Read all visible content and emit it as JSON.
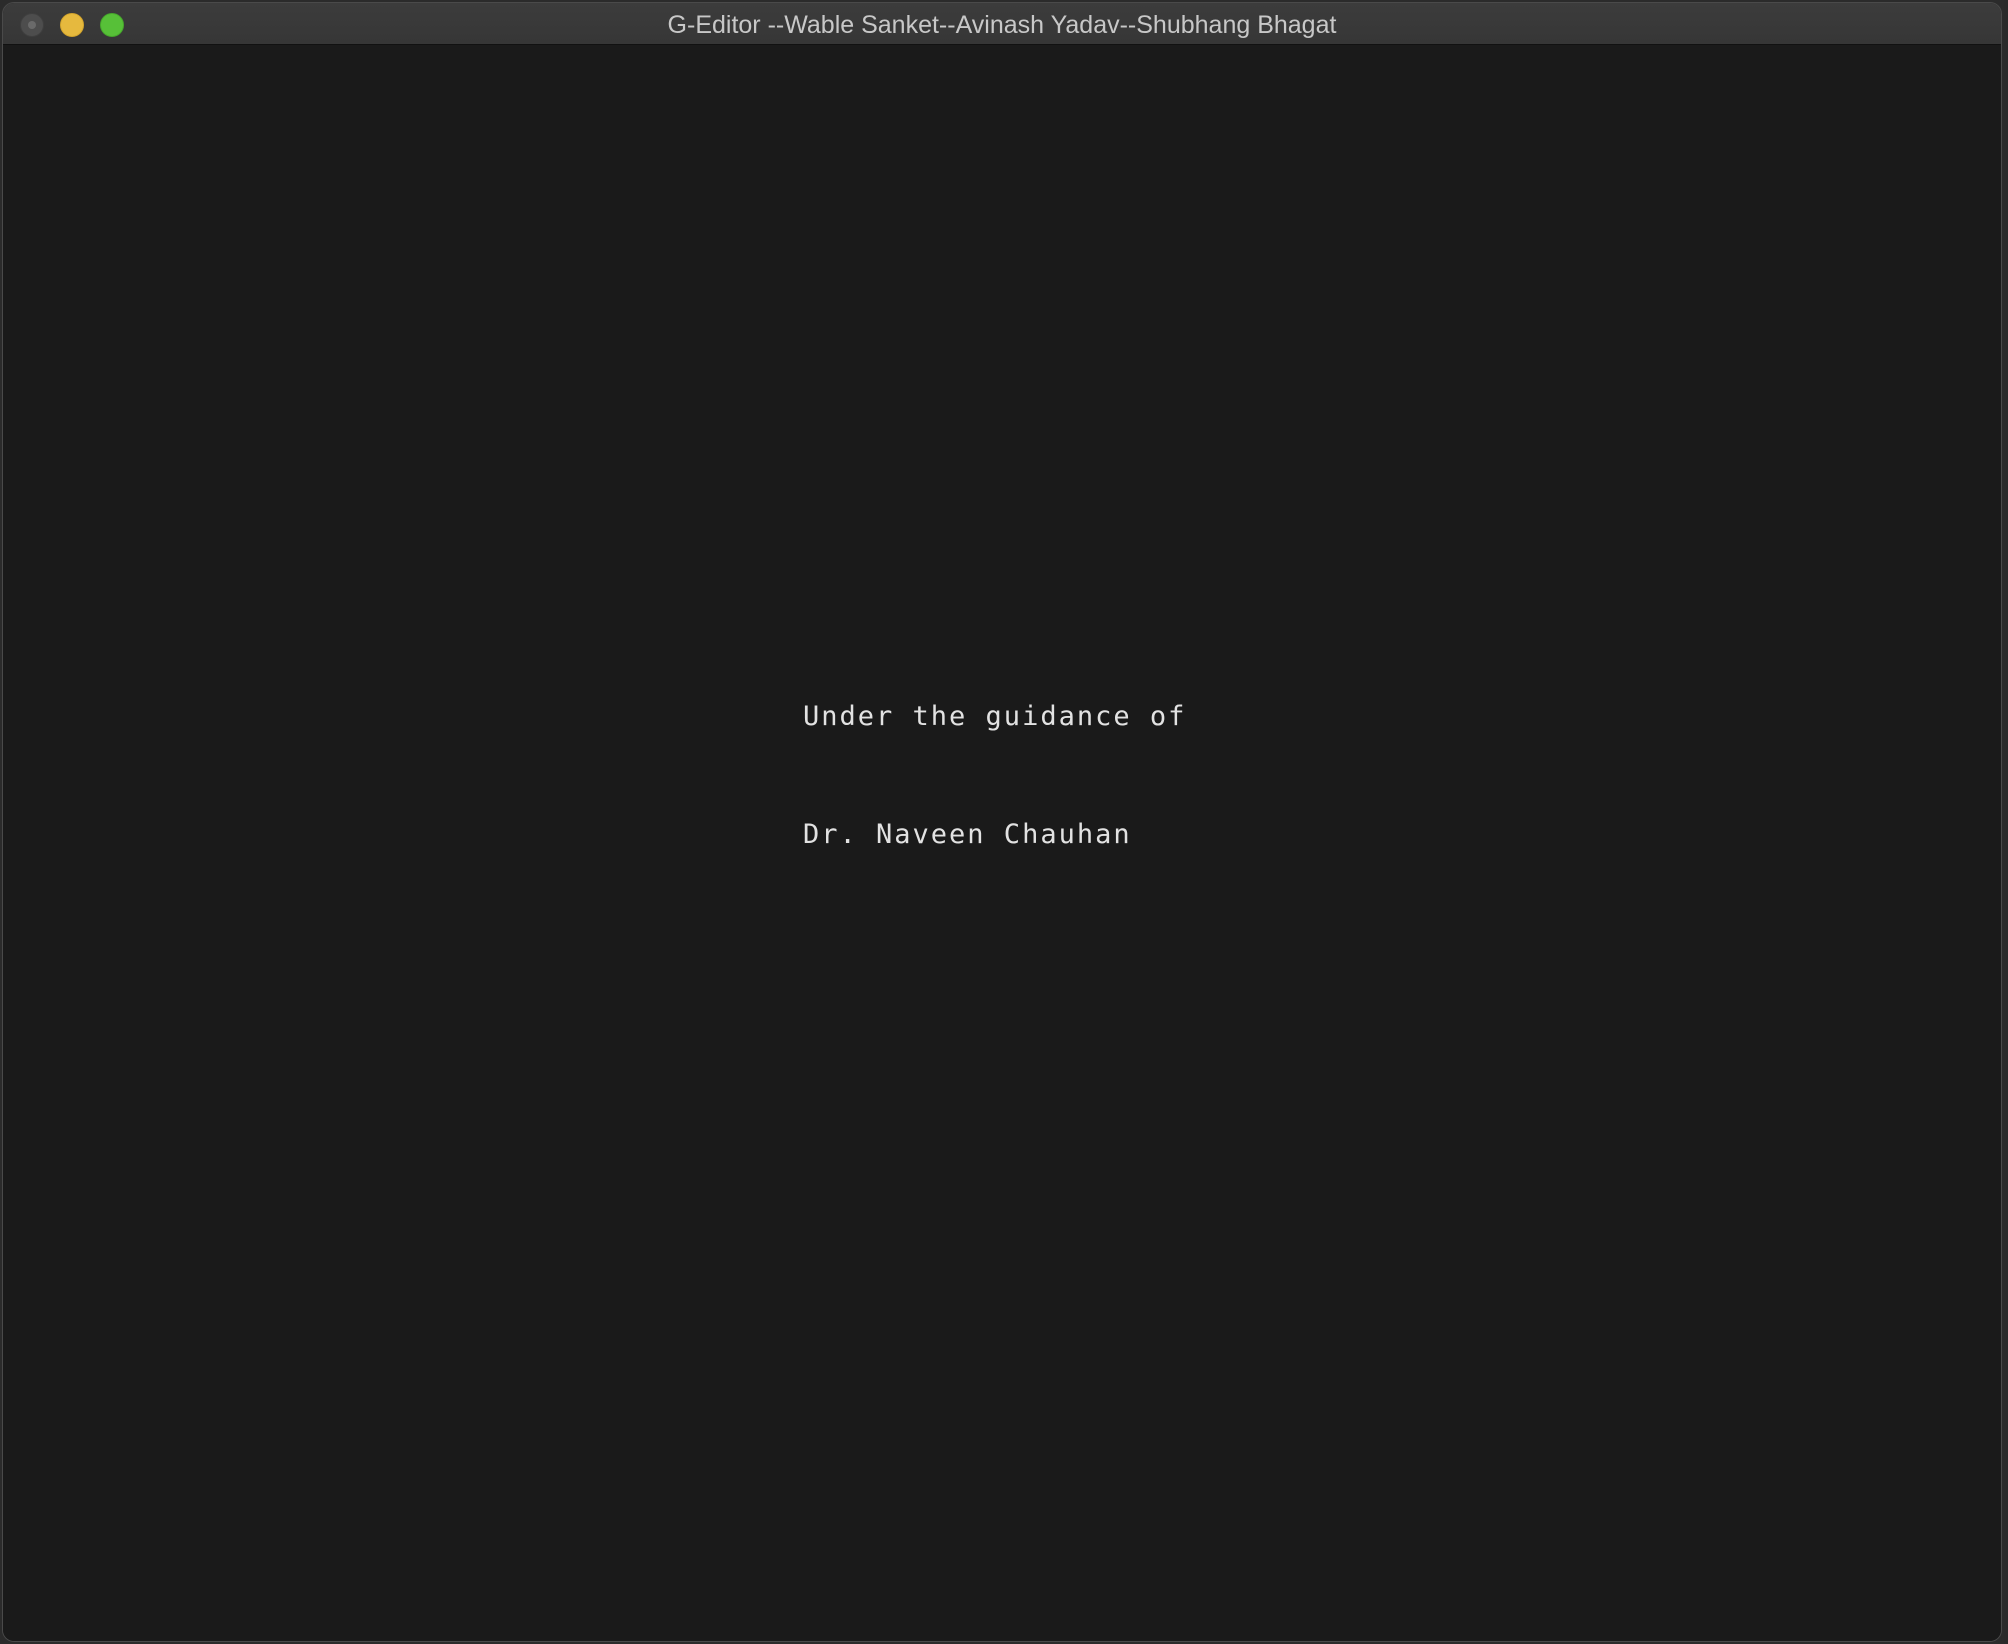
{
  "window": {
    "title": "G-Editor --Wable Sanket--Avinash Yadav--Shubhang Bhagat",
    "controls": {
      "close": "close-icon",
      "minimize": "minimize-icon",
      "zoom": "zoom-icon"
    }
  },
  "canvas": {
    "background_color": "#1a1a1a",
    "text_color": "#e2e2e2",
    "lines": [
      "Under the guidance of",
      "Dr. Naveen Chauhan"
    ]
  }
}
